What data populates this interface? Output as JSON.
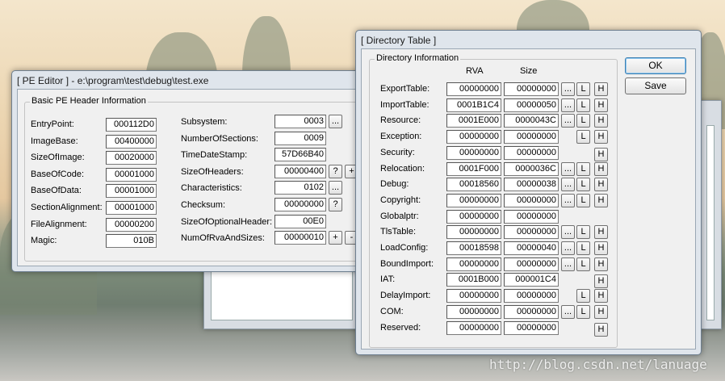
{
  "pe_editor": {
    "title": "[ PE Editor ] - e:\\program\\test\\debug\\test.exe",
    "group_title": "Basic PE Header Information",
    "left_fields": [
      {
        "label": "EntryPoint:",
        "value": "000112D0"
      },
      {
        "label": "ImageBase:",
        "value": "00400000"
      },
      {
        "label": "SizeOfImage:",
        "value": "00020000"
      },
      {
        "label": "BaseOfCode:",
        "value": "00001000"
      },
      {
        "label": "BaseOfData:",
        "value": "00001000"
      },
      {
        "label": "SectionAlignment:",
        "value": "00001000"
      },
      {
        "label": "FileAlignment:",
        "value": "00000200"
      },
      {
        "label": "Magic:",
        "value": "010B"
      }
    ],
    "right_fields": [
      {
        "label": "Subsystem:",
        "value": "0003"
      },
      {
        "label": "NumberOfSections:",
        "value": "0009"
      },
      {
        "label": "TimeDateStamp:",
        "value": "57D66B40"
      },
      {
        "label": "SizeOfHeaders:",
        "value": "00000400"
      },
      {
        "label": "Characteristics:",
        "value": "0102"
      },
      {
        "label": "Checksum:",
        "value": "00000000"
      },
      {
        "label": "SizeOfOptionalHeader:",
        "value": "00E0"
      },
      {
        "label": "NumOfRvaAndSizes:",
        "value": "00000010"
      }
    ],
    "btn_dots": "...",
    "btn_question": "?",
    "btn_plus": "+",
    "btn_minus": "-"
  },
  "directory_table": {
    "title": "[ Directory Table ]",
    "group_title": "Directory Information",
    "col_rva": "RVA",
    "col_size": "Size",
    "ok_label": "OK",
    "save_label": "Save",
    "btn_dots": "...",
    "btn_l": "L",
    "btn_h": "H",
    "rows": [
      {
        "name": "ExportTable:",
        "rva": "00000000",
        "size": "00000000"
      },
      {
        "name": "ImportTable:",
        "rva": "0001B1C4",
        "size": "00000050"
      },
      {
        "name": "Resource:",
        "rva": "0001E000",
        "size": "0000043C"
      },
      {
        "name": "Exception:",
        "rva": "00000000",
        "size": "00000000"
      },
      {
        "name": "Security:",
        "rva": "00000000",
        "size": "00000000"
      },
      {
        "name": "Relocation:",
        "rva": "0001F000",
        "size": "0000036C"
      },
      {
        "name": "Debug:",
        "rva": "00018560",
        "size": "00000038"
      },
      {
        "name": "Copyright:",
        "rva": "00000000",
        "size": "00000000"
      },
      {
        "name": "Globalptr:",
        "rva": "00000000",
        "size": "00000000"
      },
      {
        "name": "TlsTable:",
        "rva": "00000000",
        "size": "00000000"
      },
      {
        "name": "LoadConfig:",
        "rva": "00018598",
        "size": "00000040"
      },
      {
        "name": "BoundImport:",
        "rva": "00000000",
        "size": "00000000"
      },
      {
        "name": "IAT:",
        "rva": "0001B000",
        "size": "000001C4"
      },
      {
        "name": "DelayImport:",
        "rva": "00000000",
        "size": "00000000"
      },
      {
        "name": "COM:",
        "rva": "00000000",
        "size": "00000000"
      },
      {
        "name": "Reserved:",
        "rva": "00000000",
        "size": "00000000"
      }
    ]
  },
  "watermark": "http://blog.csdn.net/lanuage"
}
